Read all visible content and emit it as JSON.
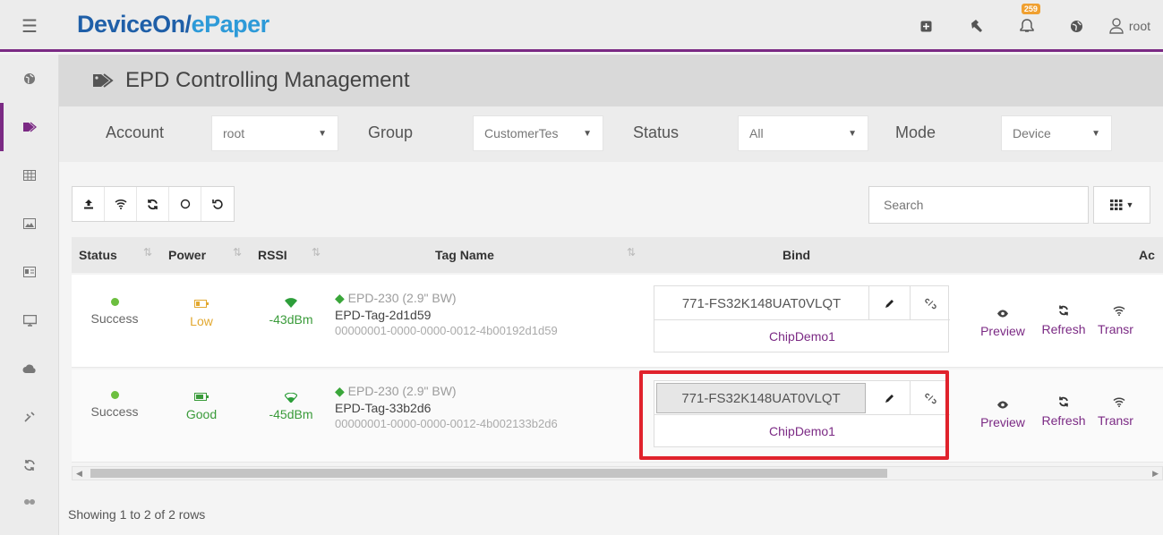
{
  "topbar": {
    "brand_part1": "DeviceOn/",
    "brand_part2": "ePaper",
    "badge": "259",
    "user": "root"
  },
  "sidebar": {
    "items": [
      "globe-icon",
      "tag-icon",
      "table-icon",
      "image-icon",
      "id-card-icon",
      "monitor-icon",
      "cloud-icon",
      "tools-icon",
      "refresh-icon",
      "users-icon"
    ]
  },
  "page": {
    "title": "EPD Controlling Management"
  },
  "filters": {
    "account_label": "Account",
    "account_value": "root",
    "group_label": "Group",
    "group_value": "CustomerTes",
    "status_label": "Status",
    "status_value": "All",
    "mode_label": "Mode",
    "mode_value": "Device"
  },
  "search": {
    "placeholder": "Search"
  },
  "table": {
    "headers": {
      "status": "Status",
      "power": "Power",
      "rssi": "RSSI",
      "tag_name": "Tag Name",
      "bind": "Bind",
      "action": "Ac"
    },
    "rows": [
      {
        "status": "Success",
        "power": "Low",
        "rssi": "-43dBm",
        "tag_type": "EPD-230 (2.9\" BW)",
        "tag_name": "EPD-Tag-2d1d59",
        "tag_id": "00000001-0000-0000-0012-4b00192d1d59",
        "bind_value": "771-FS32K148UAT0VLQT",
        "bind_name": "ChipDemo1",
        "actions": [
          "Preview",
          "Refresh",
          "Transr"
        ]
      },
      {
        "status": "Success",
        "power": "Good",
        "rssi": "-45dBm",
        "tag_type": "EPD-230 (2.9\" BW)",
        "tag_name": "EPD-Tag-33b2d6",
        "tag_id": "00000001-0000-0000-0012-4b002133b2d6",
        "bind_value": "771-FS32K148UAT0VLQT",
        "bind_name": "ChipDemo1",
        "actions": [
          "Preview",
          "Refresh",
          "Transr"
        ]
      }
    ]
  },
  "footer": {
    "rows_info": "Showing 1 to 2 of 2 rows"
  },
  "colors": {
    "accent": "#7b2a84",
    "brand_dark": "#1f5fa8",
    "brand_light": "#2d9ad8",
    "highlight": "#e0222c",
    "success": "#6cbf3f",
    "low": "#e2a830"
  }
}
